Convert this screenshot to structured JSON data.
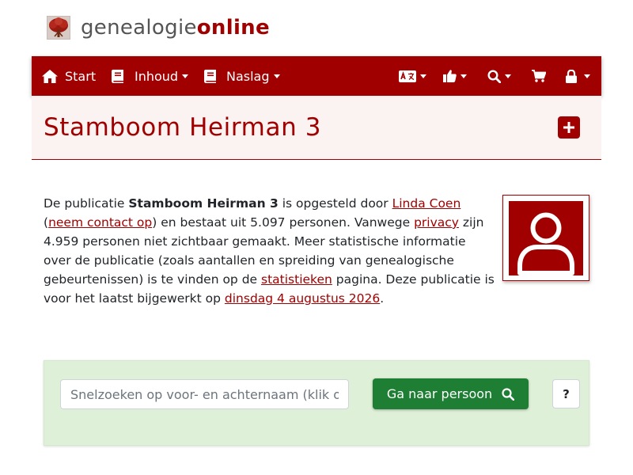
{
  "brand": {
    "part1": "genealogie",
    "part2": "online"
  },
  "nav": {
    "start": "Start",
    "inhoud": "Inhoud",
    "naslag": "Naslag"
  },
  "title": "Stamboom Heirman 3",
  "intro": {
    "s1": "De publicatie ",
    "publication": "Stamboom Heirman 3",
    "s2": " is opgesteld door ",
    "author": "Linda Coen",
    "s3": "(",
    "contact": "neem contact op",
    "s4": ") en bestaat uit 5.097 personen. Vanwege ",
    "privacy": "privacy",
    "s5": " zijn 4.959 personen niet zichtbaar gemaakt. Meer statistische informatie over de publicatie (zoals aantallen en spreiding van genealogische gebeurtenissen) is te vinden op de ",
    "stats": "statistieken",
    "s6": " pagina. Deze publicatie is voor het laatst bijgewerkt op ",
    "date": "dinsdag 4 augustus 2026",
    "s7": "."
  },
  "search": {
    "placeholder": "Snelzoeken op voor- en achternaam (klik op ? voor meer info)",
    "button": "Ga naar persoon",
    "help": "?"
  },
  "icons": {
    "logo": "tree-logo-icon",
    "start": "home-icon",
    "inhoud": "book-icon",
    "naslag": "book-icon",
    "language": "language-icon",
    "like": "thumbs-up-icon",
    "search": "search-icon",
    "cart": "cart-icon",
    "lock": "lock-icon",
    "add": "plus-square-icon",
    "avatar": "person-icon"
  },
  "colors": {
    "brand": "#a00000",
    "title_bg": "#fbf2f2",
    "search_panel": "#dff0d8",
    "go_button": "#1e7e34"
  }
}
